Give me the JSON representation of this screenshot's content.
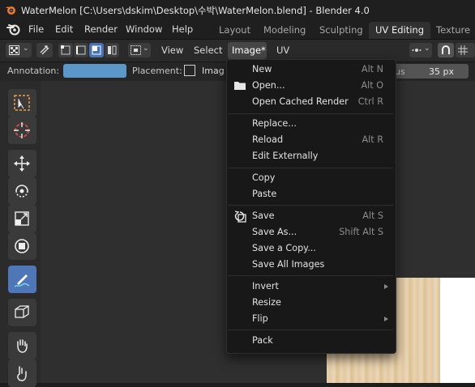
{
  "window": {
    "title": "WaterMelon [C:\\Users\\dskim\\Desktop\\수박\\WaterMelon.blend] - Blender 4.0"
  },
  "menubar": {
    "items": [
      "File",
      "Edit",
      "Render",
      "Window",
      "Help"
    ],
    "workspaces": [
      "Layout",
      "Modeling",
      "Sculpting",
      "UV Editing",
      "Texture P"
    ],
    "active_workspace": "UV Editing"
  },
  "editor_header": {
    "view_label": "View",
    "select_label": "Select",
    "image_label": "Image*",
    "uv_label": "UV"
  },
  "tool_settings": {
    "annotation_label": "Annotation:",
    "annotation_color": "#5b97c9",
    "placement_label": "Placement:",
    "placement_value": "Imag",
    "radius_value": "35 px",
    "radius_unit_partial": "us"
  },
  "toolbar": {
    "tools": [
      "select-box",
      "cursor",
      "move",
      "rotate",
      "scale",
      "transform",
      "annotate",
      "box-grab",
      "grab",
      "pinch"
    ],
    "active_tool": "annotate"
  },
  "image_menu": {
    "groups": [
      [
        {
          "label": "New",
          "shortcut": "Alt N"
        },
        {
          "label": "Open...",
          "shortcut": "Alt O",
          "icon": "folder-icon"
        },
        {
          "label": "Open Cached Render",
          "shortcut": "Ctrl R"
        }
      ],
      [
        {
          "label": "Replace...",
          "shortcut": ""
        },
        {
          "label": "Reload",
          "shortcut": "Alt R"
        },
        {
          "label": "Edit Externally",
          "shortcut": ""
        }
      ],
      [
        {
          "label": "Copy",
          "shortcut": ""
        },
        {
          "label": "Paste",
          "shortcut": ""
        }
      ],
      [
        {
          "label": "Save",
          "shortcut": "Alt S",
          "icon": "save-icon"
        },
        {
          "label": "Save As...",
          "shortcut": "Shift Alt S"
        },
        {
          "label": "Save a Copy...",
          "shortcut": ""
        },
        {
          "label": "Save All Images",
          "shortcut": ""
        }
      ],
      [
        {
          "label": "Invert",
          "shortcut": "",
          "submenu": true
        },
        {
          "label": "Resize",
          "shortcut": ""
        },
        {
          "label": "Flip",
          "shortcut": "",
          "submenu": true
        }
      ],
      [
        {
          "label": "Pack",
          "shortcut": ""
        }
      ]
    ]
  }
}
